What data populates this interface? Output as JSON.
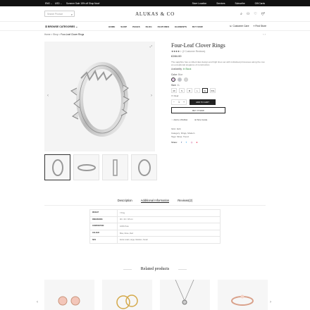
{
  "topbar": {
    "language": "ENG",
    "currency": "USD",
    "promo": "Summer Sale 15% off Shop Now!",
    "links": [
      "Store Location",
      "Services",
      "Subscribe",
      "Gift Cards"
    ]
  },
  "header": {
    "search_placeholder": "Search Product",
    "logo": "ALUKAS & CO",
    "cart_count": "0"
  },
  "nav": {
    "browse": "BROWSE CATEGORIES",
    "menu": [
      "HOME",
      "SHOP",
      "PAGES",
      "BLOG",
      "FEATURES",
      "ELEMENTS",
      "BUY NOW"
    ],
    "customer_care": "Customer Care",
    "find_store": "Find Store"
  },
  "breadcrumb": [
    "Home",
    "Shop",
    "Four-Leaf Clover Rings"
  ],
  "product": {
    "title": "Four-Leaf Clover Rings",
    "stars": "★★★★☆",
    "reviews": "(2 Customer Reviews)",
    "price": "£284.00",
    "description": "The sapphire has a milled claw design and high lines set with individual princesses along the row an exceptional elegance of construction.",
    "availability_label": "Availability:",
    "availability_value": "In Stock",
    "color_label": "Color:",
    "color_value": "Blue",
    "colors": [
      "#e8cfea",
      "#bfc2cc",
      "#d7d7d7"
    ],
    "size_label": "Size:",
    "size_value": "XL",
    "sizes": [
      "4X",
      "S",
      "M",
      "L",
      "XL",
      "XXL"
    ],
    "selected_size": "XL",
    "clear": "✕ Clear",
    "qty": "1",
    "add_to_cart": "ADD TO CART",
    "buy_now": "BUY IT NOW",
    "wishlist": "Add to Wishlist",
    "size_guide": "Size Guide",
    "sku_label": "SKU:",
    "sku": "D20",
    "category_label": "Category:",
    "category": "Rings, Modern",
    "tags_label": "Tags:",
    "tags": "Silver, Trend",
    "share_label": "Share:"
  },
  "tabs": [
    "Description",
    "Additional Information",
    "Reviews(2)"
  ],
  "specs": [
    {
      "k": "WEIGHT",
      "v": "7.8 kg"
    },
    {
      "k": "DIMENSIONS",
      "v": "90 × 40 × 95 cm"
    },
    {
      "k": "COMPOSITION",
      "v": "100% Pure"
    },
    {
      "k": "COLOUR",
      "v": "Blue, Rose, Red"
    },
    {
      "k": "SIZE",
      "v": "Extra small, Large, Medium, Small"
    }
  ],
  "related_title": "Related products"
}
